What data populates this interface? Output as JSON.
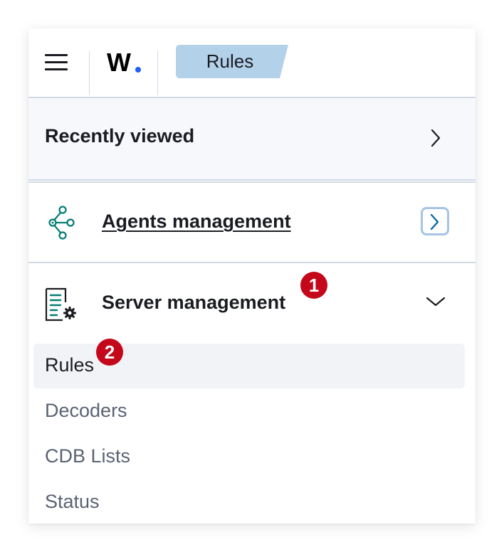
{
  "header": {
    "logo_text": "W",
    "breadcrumb": "Rules"
  },
  "recently_viewed": {
    "label": "Recently viewed"
  },
  "agents_management": {
    "label": "Agents management",
    "icon": "network-nodes-icon"
  },
  "server_management": {
    "label": "Server management",
    "icon": "document-gear-icon",
    "items": [
      {
        "label": "Rules",
        "active": true
      },
      {
        "label": "Decoders",
        "active": false
      },
      {
        "label": "CDB Lists",
        "active": false
      },
      {
        "label": "Status",
        "active": false
      }
    ]
  },
  "callouts": [
    "1",
    "2"
  ],
  "colors": {
    "accent": "#1f5eff",
    "breadcrumb_bg": "#b4d1ea",
    "badge": "#c4071a",
    "agents_icon": "#017d73"
  }
}
